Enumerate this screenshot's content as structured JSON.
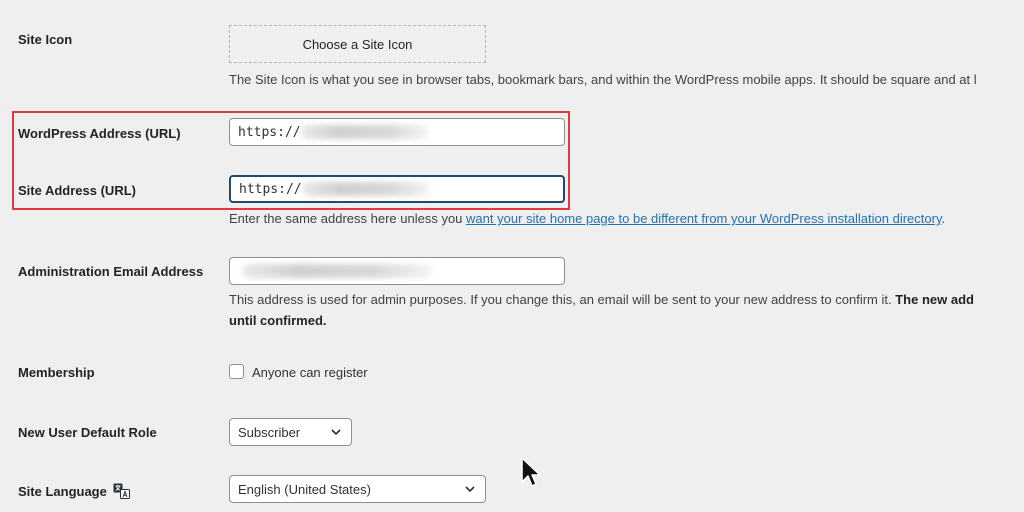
{
  "site_icon": {
    "label": "Site Icon",
    "button_label": "Choose a Site Icon",
    "description": "The Site Icon is what you see in browser tabs, bookmark bars, and within the WordPress mobile apps. It should be square and at l"
  },
  "wp_address": {
    "label": "WordPress Address (URL)",
    "value_prefix": "https://"
  },
  "site_address": {
    "label": "Site Address (URL)",
    "value_prefix": "https://",
    "description_prefix": "Enter the same address here unless you ",
    "description_link": "want your site home page to be different from your WordPress installation directory",
    "description_suffix": "."
  },
  "admin_email": {
    "label": "Administration Email Address",
    "description_line1": "This address is used for admin purposes. If you change this, an email will be sent to your new address to confirm it. ",
    "description_bold": "The new add",
    "description_line2": "until confirmed."
  },
  "membership": {
    "label": "Membership",
    "checkbox_label": "Anyone can register",
    "checked": false
  },
  "default_role": {
    "label": "New User Default Role",
    "selected": "Subscriber"
  },
  "site_language": {
    "label": "Site Language",
    "selected": "English (United States)"
  },
  "colors": {
    "highlight": "#e03a3e",
    "link": "#2271b1"
  },
  "icons": [
    "translation-icon",
    "chevron-down-icon",
    "mouse-cursor-icon"
  ]
}
